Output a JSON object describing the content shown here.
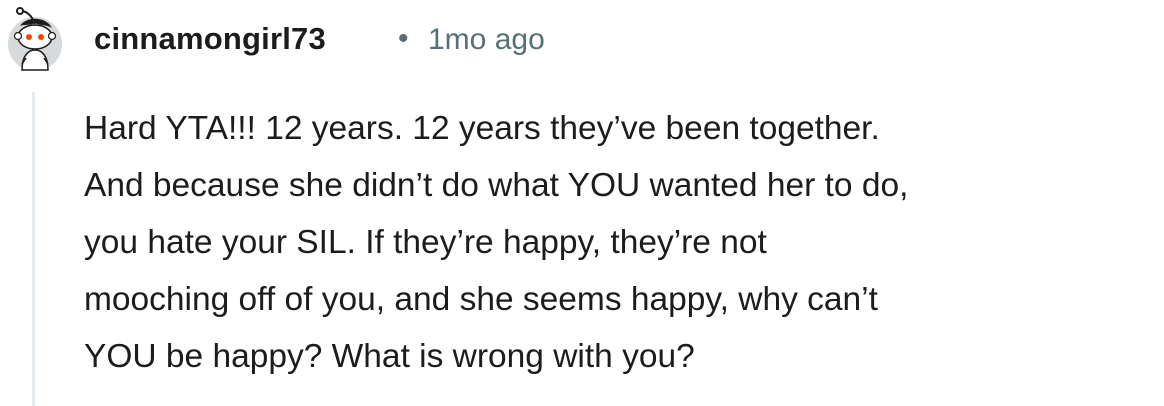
{
  "comment": {
    "author": "cinnamongirl73",
    "separator": "•",
    "timestamp": "1mo ago",
    "body_lines": [
      "Hard YTA!!! 12 years. 12 years they’ve been together.",
      "And because she didn’t do what YOU wanted her to do,",
      "you hate your SIL. If they’re happy, they’re not",
      "mooching off of you, and she seems happy, why can’t",
      "YOU be happy? What is wrong with you?"
    ],
    "avatar_icon": "snoo-avatar-icon"
  },
  "colors": {
    "text": "#1c1c1c",
    "meta": "#576f76",
    "thread_line": "#e5ebee",
    "background": "#ffffff"
  }
}
